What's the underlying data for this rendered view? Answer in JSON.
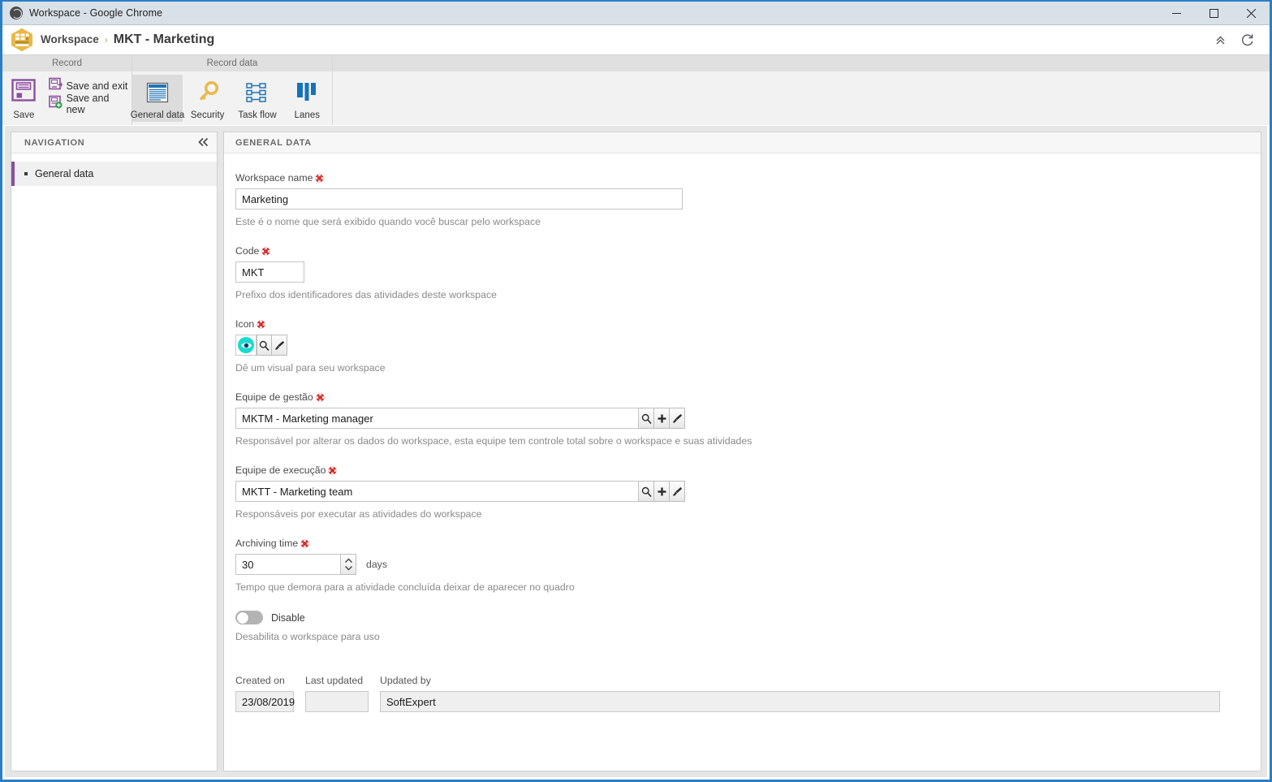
{
  "window": {
    "title": "Workspace - Google Chrome",
    "app_icon": "globe-icon",
    "minimize_label": "Minimize",
    "maximize_label": "Maximize",
    "close_label": "Close"
  },
  "header": {
    "logo_icon": "workspace-hexagon-icon",
    "breadcrumb_root": "Workspace",
    "breadcrumb_separator": "›",
    "breadcrumb_current": "MKT - Marketing",
    "collapse_icon": "chevron-double-up-icon",
    "refresh_icon": "refresh-icon"
  },
  "ribbon": {
    "groups": [
      {
        "title": "Record",
        "big_button": {
          "label": "Save",
          "icon": "floppy-disk-icon"
        },
        "small_buttons": [
          {
            "label": "Save and exit",
            "icon": "save-exit-icon"
          },
          {
            "label": "Save and new",
            "icon": "save-new-icon"
          }
        ]
      },
      {
        "title": "Record data",
        "tabs": [
          {
            "label": "General data",
            "icon": "document-icon",
            "active": true
          },
          {
            "label": "Security",
            "icon": "key-icon",
            "active": false
          },
          {
            "label": "Task flow",
            "icon": "task-flow-icon",
            "active": false
          },
          {
            "label": "Lanes",
            "icon": "lanes-icon",
            "active": false
          }
        ]
      },
      {
        "title": ""
      }
    ]
  },
  "navigation": {
    "title": "NAVIGATION",
    "collapse_icon": "chevron-double-left-icon",
    "items": [
      {
        "label": "General data",
        "selected": true
      }
    ]
  },
  "content": {
    "panel_title": "GENERAL DATA",
    "fields": {
      "workspace_name": {
        "label": "Workspace name",
        "required": true,
        "value": "Marketing",
        "hint": "Este é o nome que será exibido quando você buscar pelo workspace"
      },
      "code": {
        "label": "Code",
        "required": true,
        "value": "MKT",
        "hint": "Prefixo dos identificadores das atividades deste workspace"
      },
      "icon": {
        "label": "Icon",
        "required": true,
        "selected_icon": "eye-icon",
        "search_icon": "magnifier-icon",
        "clear_icon": "brush-icon",
        "hint": "Dê um visual para seu workspace"
      },
      "management_team": {
        "label": "Equipe de gestão",
        "required": true,
        "value": "MKTM - Marketing manager",
        "search_icon": "magnifier-icon",
        "add_icon": "plus-icon",
        "clear_icon": "brush-icon",
        "hint": "Responsável por alterar os dados do workspace, esta equipe tem controle total sobre o workspace e suas atividades"
      },
      "execution_team": {
        "label": "Equipe de execução",
        "required": true,
        "value": "MKTT - Marketing team",
        "search_icon": "magnifier-icon",
        "add_icon": "plus-icon",
        "clear_icon": "brush-icon",
        "hint": "Responsáveis por executar as atividades do workspace"
      },
      "archiving_time": {
        "label": "Archiving time",
        "required": true,
        "value": "30",
        "unit": "days",
        "spinner_icon": "spinner-updown-icon",
        "hint": "Tempo que demora para a atividade concluída deixar de aparecer no quadro"
      },
      "disable": {
        "label": "Disable",
        "checked": false,
        "hint": "Desabilita o workspace para uso"
      }
    },
    "meta": {
      "created_on_label": "Created on",
      "created_on_value": "23/08/2019",
      "last_updated_label": "Last updated",
      "last_updated_value": "",
      "updated_by_label": "Updated by",
      "updated_by_value": "SoftExpert"
    }
  },
  "colors": {
    "accent_blue": "#2b7fc4",
    "save_purple": "#8b4f9e",
    "logo_orange": "#e8b94a",
    "icon_cyan": "#18dccd",
    "required_red": "#d32f2f"
  }
}
